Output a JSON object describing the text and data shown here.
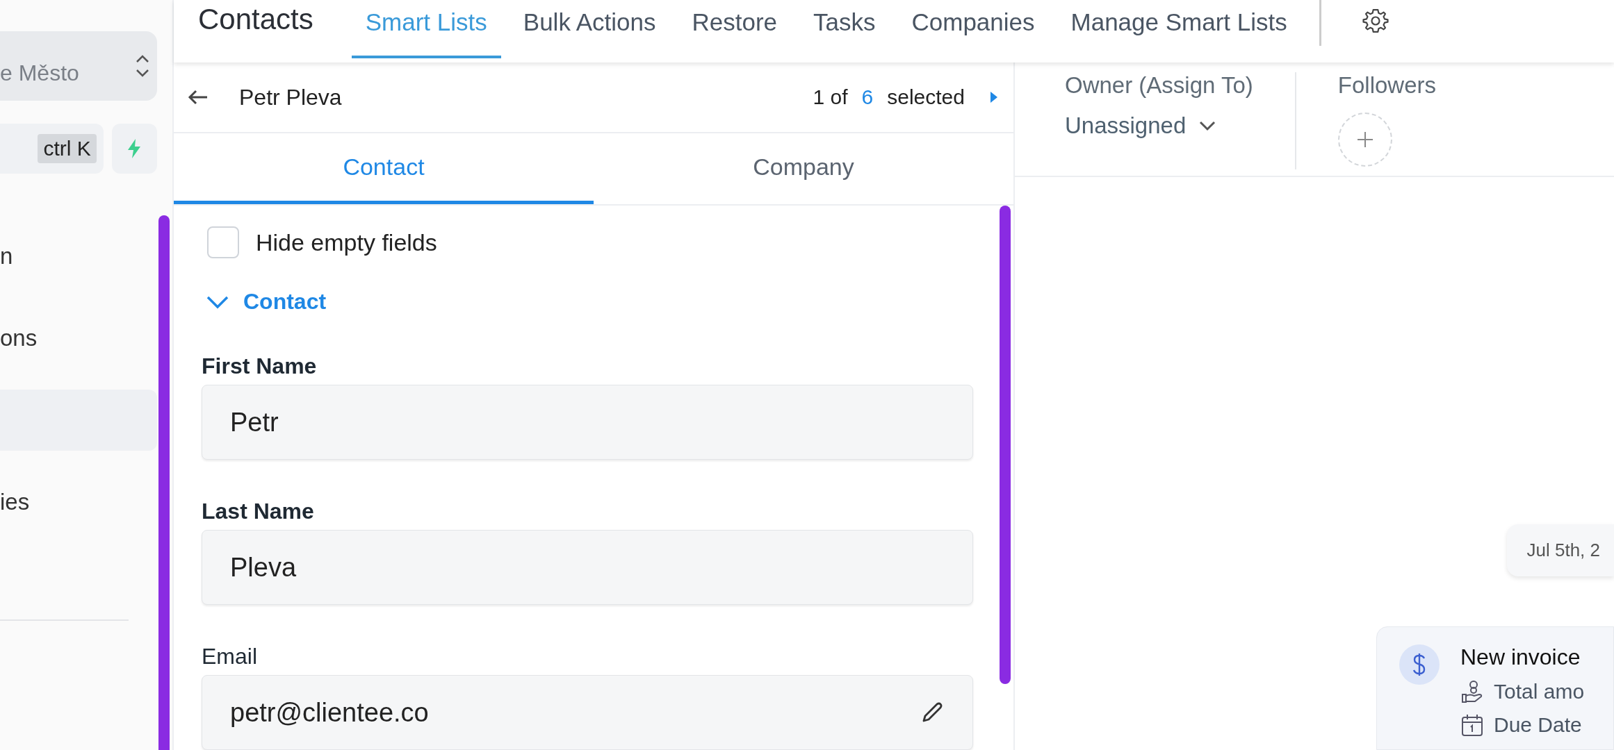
{
  "sidebar": {
    "location": {
      "value": "e Město"
    },
    "search": {
      "shortcut": "ctrl K"
    },
    "items": [
      {
        "label": "n",
        "selected": false
      },
      {
        "label": "ons",
        "selected": false
      },
      {
        "selected": true
      },
      {
        "label": "ies",
        "selected": false
      }
    ]
  },
  "header": {
    "title": "Contacts",
    "tabs": [
      {
        "label": "Smart Lists",
        "selected": true
      },
      {
        "label": "Bulk Actions",
        "selected": false
      },
      {
        "label": "Restore",
        "selected": false
      },
      {
        "label": "Tasks",
        "selected": false
      },
      {
        "label": "Companies",
        "selected": false
      },
      {
        "label": "Manage Smart Lists",
        "selected": false
      }
    ]
  },
  "record": {
    "name": "Petr Pleva",
    "position": "1 of",
    "total": "6",
    "suffix": "selected",
    "tabs": [
      {
        "label": "Contact",
        "selected": true
      },
      {
        "label": "Company",
        "selected": false
      }
    ],
    "hide_empty": {
      "label": "Hide empty fields",
      "checked": false
    },
    "section": {
      "title": "Contact",
      "expanded": true
    },
    "fields": [
      {
        "kind": "name",
        "label": "First Name",
        "value": "Petr"
      },
      {
        "kind": "name",
        "label": "Last Name",
        "value": "Pleva"
      },
      {
        "kind": "email",
        "label": "Email",
        "value": "petr@clientee.co"
      }
    ]
  },
  "owner": {
    "label": "Owner (Assign To)",
    "value": "Unassigned"
  },
  "followers": {
    "label": "Followers"
  },
  "activity": {
    "date": "Jul 5th, 2",
    "items": [
      {
        "title": "New invoice",
        "lines": [
          {
            "kind": "amount",
            "text": "Total amo"
          },
          {
            "kind": "due",
            "text": "Due Date"
          }
        ]
      }
    ]
  }
}
